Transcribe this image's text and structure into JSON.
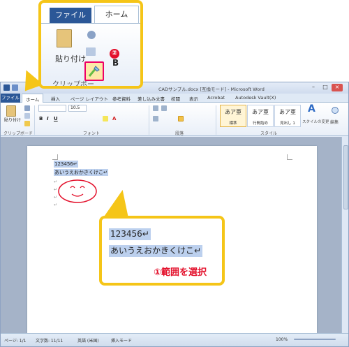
{
  "window": {
    "title": "CADサンプル.docx [互換モード] - Microsoft Word",
    "controls": [
      "–",
      "□",
      "×"
    ]
  },
  "tabs": {
    "file": "ファイル",
    "items": [
      "ホーム",
      "挿入",
      "ページ レイアウト",
      "参考資料",
      "差し込み文書",
      "校閲",
      "表示",
      "Acrobat",
      "Autodesk Vault(X)"
    ]
  },
  "ribbon": {
    "paste": "貼り付け",
    "font_name": "",
    "font_size": "10.5",
    "groups": {
      "clipboard": "クリップボード",
      "font": "フォント",
      "paragraph": "段落",
      "style": "スタイル"
    },
    "styles": [
      {
        "sample": "あア亜",
        "name": "標準"
      },
      {
        "sample": "あア亜",
        "name": "行間詰め"
      },
      {
        "sample": "あア亜",
        "name": "見出し 1"
      }
    ],
    "change_style": "スタイルの変更",
    "edit": "編集"
  },
  "document": {
    "line1": "123456↵",
    "line2": "あいうえおかきくけこ↵",
    "para_marks": [
      "↵",
      "↵",
      "↵",
      "↵"
    ]
  },
  "status": {
    "page": "ページ: 1/1",
    "words": "文字数: 11/11",
    "lang": "英語 (米国)",
    "mode": "挿入モード",
    "zoom": "100%"
  },
  "callout_top": {
    "file": "ファイル",
    "home": "ホーム",
    "paste": "貼り付け",
    "group": "クリップボー",
    "step": "②"
  },
  "callout_mid": {
    "line1": "123456↵",
    "line2": "あいうえおかきくけこ↵",
    "instruction": "①範囲を選択"
  },
  "colors": {
    "accent": "#f5c518",
    "file_tab": "#2b5797",
    "selection": "#bcd0ee",
    "red": "#e3102b"
  }
}
